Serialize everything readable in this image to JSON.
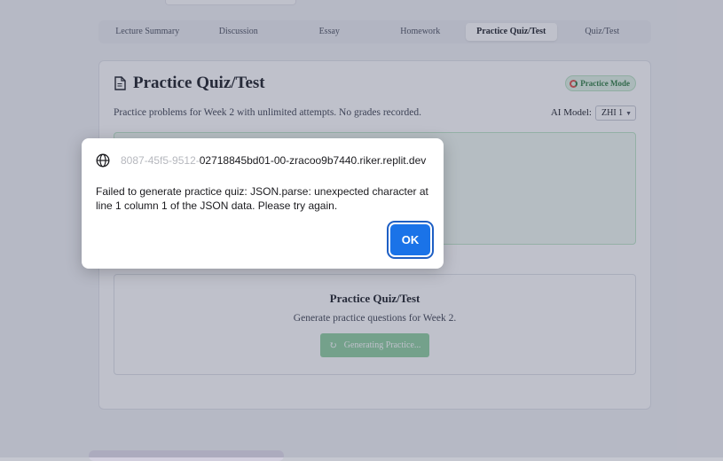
{
  "tabs": [
    {
      "label": "Lecture Summary"
    },
    {
      "label": "Discussion"
    },
    {
      "label": "Essay"
    },
    {
      "label": "Homework"
    },
    {
      "label": "Practice Quiz/Test",
      "active": true
    },
    {
      "label": "Quiz/Test"
    }
  ],
  "card": {
    "title": "Practice Quiz/Test",
    "title_icon": "document-icon",
    "badge": "Practice Mode",
    "subtitle": "Practice problems for Week 2 with unlimited attempts. No grades recorded.",
    "model_label": "AI Model:",
    "model_value": "ZHI 1"
  },
  "generator": {
    "title": "Practice Quiz/Test",
    "subtitle": "Generate practice questions for Week 2.",
    "button_label": "Generating Practice...",
    "button_icon": "refresh-icon"
  },
  "dialog": {
    "origin_faded": "8087-45f5-9512-",
    "origin": "02718845bd01-00-zracoo9b7440.riker.replit.dev",
    "origin_icon": "globe-icon",
    "message": "Failed to generate practice quiz: JSON.parse: unexpected character at line 1 column 1 of the JSON data. Please try again.",
    "ok_label": "OK"
  },
  "colors": {
    "accent": "#1a73e8",
    "badge_green": "#2e7d42",
    "button_green": "#8fd0a0",
    "panel_green": "#f0faf2"
  }
}
